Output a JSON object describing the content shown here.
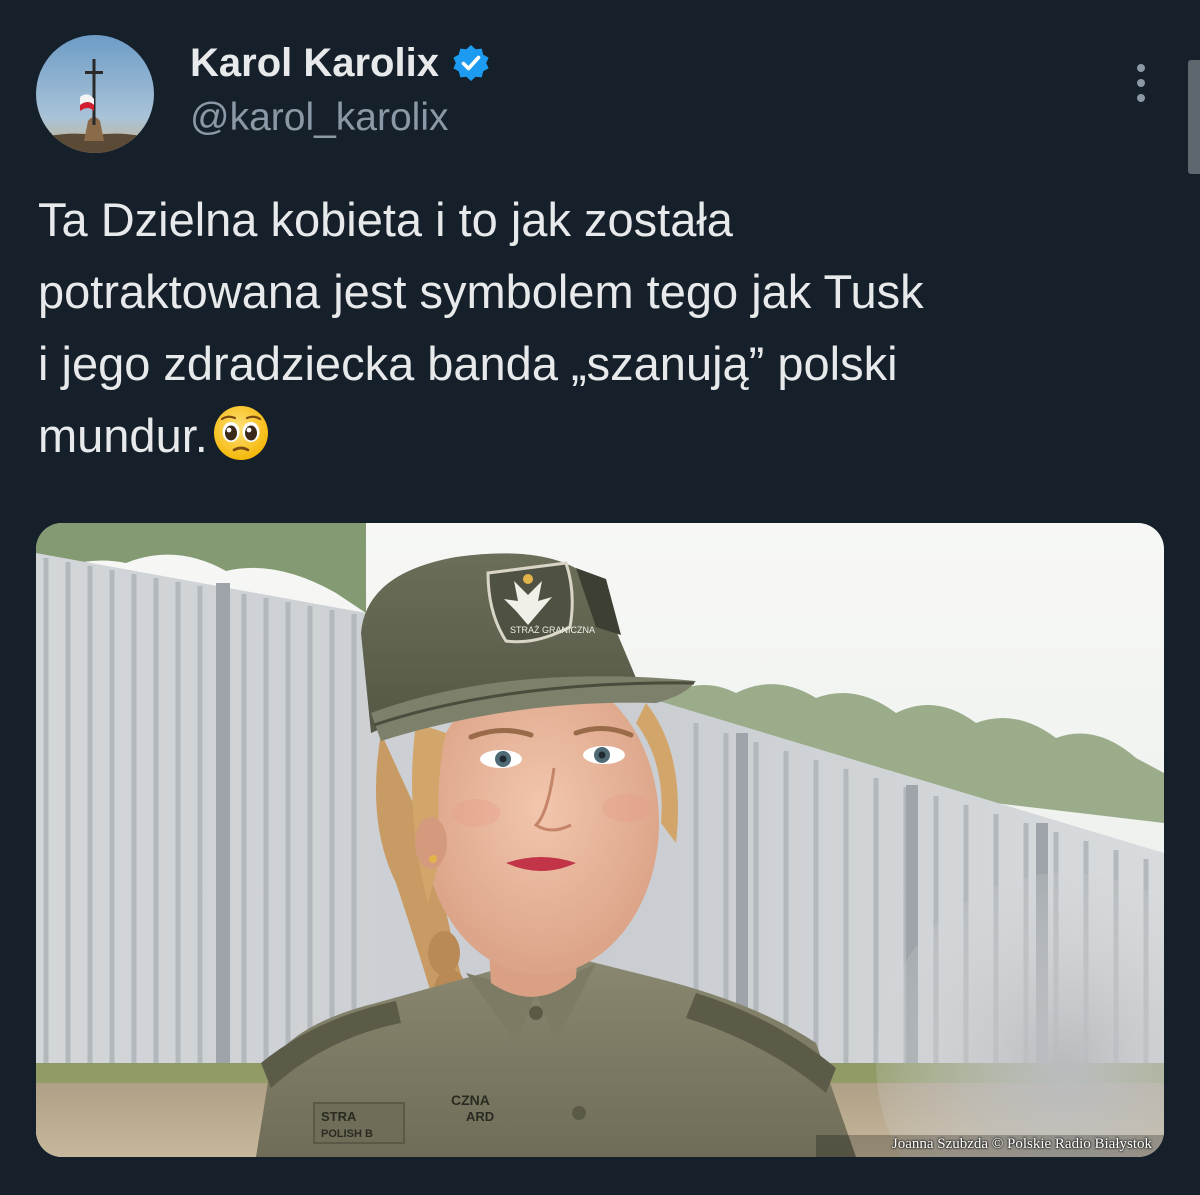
{
  "author": {
    "display_name": "Karol Karolix",
    "handle": "@karol_karolix",
    "verified": true,
    "verified_color": "#1d9bf0",
    "avatar_icon": "avatar-cross-flag-icon"
  },
  "tweet": {
    "text_lines": [
      "Ta Dzielna kobieta i to jak została",
      "potraktowana jest symbolem tego jak Tusk",
      "i jego zdradziecka banda „szanują” polski",
      "mundur."
    ],
    "emoji": "pleading-face-icon"
  },
  "media": {
    "photo_credit": "Joanna Szubzda © Polskie Radio Białystok",
    "cap_patch_text": "STRAŻ GRANICZNA",
    "shirt_patch_left": "STRA... POLISH B...",
    "shirt_patch_right": "...CZNA ...ARD"
  },
  "controls": {
    "more_icon": "more-vertical-icon"
  },
  "colors": {
    "background": "#15202b",
    "text_primary": "#e7e9ea",
    "text_secondary": "#8b98a5",
    "accent": "#1d9bf0"
  }
}
